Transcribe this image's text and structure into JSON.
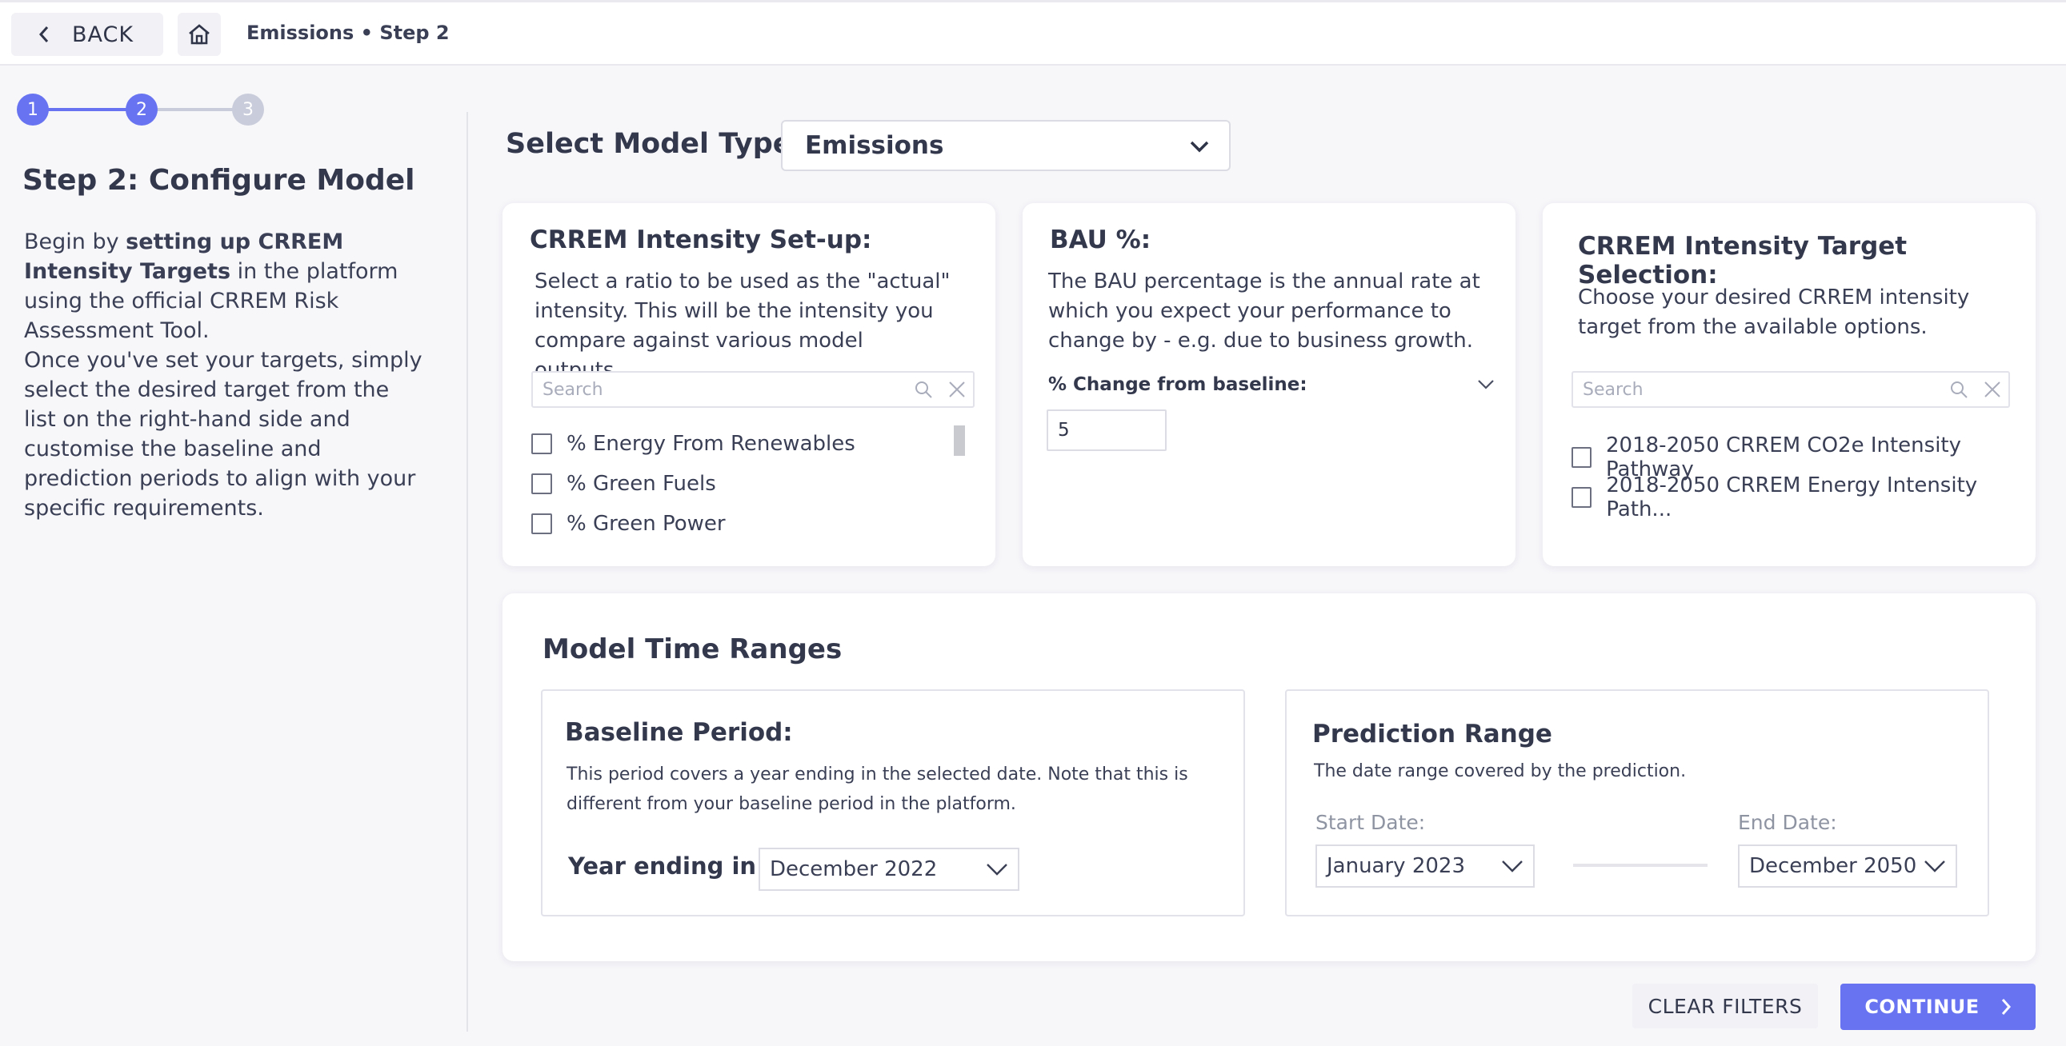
{
  "header": {
    "back_label": "BACK",
    "breadcrumb": "Emissions • Step 2"
  },
  "stepper": {
    "steps": [
      "1",
      "2",
      "3"
    ],
    "active_color": "#6773f0",
    "inactive_color": "#c9ccda"
  },
  "left": {
    "title": "Step 2: Configure Model",
    "p1_pre": "Begin by ",
    "p1_bold": "setting up CRREM Intensity Targets",
    "p1_post": " in the platform using the official CRREM Risk Assessment Tool.",
    "p2": "Once you've set your targets, simply select the desired target from the list on the right-hand side and customise the baseline and prediction periods to align with your specific requirements."
  },
  "model_type": {
    "label": "Select Model Type:",
    "value": "Emissions"
  },
  "crrem_setup": {
    "title": "CRREM Intensity Set-up:",
    "description": "Select a ratio to be used as the \"actual\" intensity. This will be the intensity you compare against various model outputs.",
    "search_placeholder": "Search",
    "options": [
      "% Energy From Renewables",
      "% Green Fuels",
      "% Green Power"
    ]
  },
  "bau": {
    "title": "BAU %:",
    "description": "The BAU percentage is the annual rate at which you expect your performance to change by - e.g. due to business growth.",
    "field_label": "% Change from baseline:",
    "value": "5"
  },
  "target_selection": {
    "title": "CRREM Intensity Target Selection:",
    "description": "Choose your desired CRREM intensity target from the available options.",
    "search_placeholder": "Search",
    "options": [
      "2018-2050 CRREM CO2e Intensity Pathway",
      "2018-2050 CRREM Energy Intensity Path..."
    ]
  },
  "time_ranges": {
    "title": "Model Time Ranges",
    "baseline": {
      "title": "Baseline Period:",
      "description": "This period covers a year ending in the selected date. Note that this is different from your baseline period in the platform.",
      "year_label": "Year ending in:",
      "year_value": "December 2022"
    },
    "prediction": {
      "title": "Prediction Range",
      "description": "The date range covered by the prediction.",
      "start_label": "Start Date:",
      "start_value": "January 2023",
      "end_label": "End Date:",
      "end_value": "December 2050"
    }
  },
  "footer": {
    "clear_label": "CLEAR FILTERS",
    "continue_label": "CONTINUE"
  }
}
